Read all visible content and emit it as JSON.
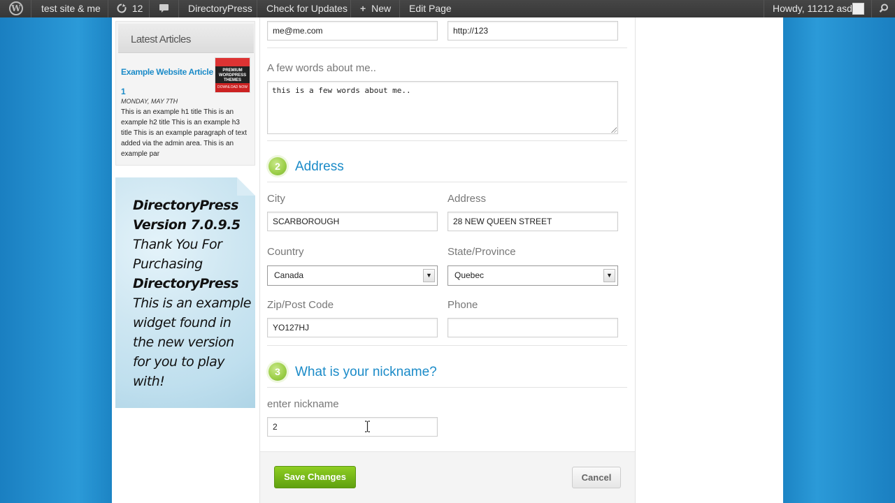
{
  "adminbar": {
    "site_name": "test site & me",
    "updates_count": "12",
    "plugin": "DirectoryPress",
    "check_updates": "Check for Updates",
    "new_label": "New",
    "edit_page": "Edit Page",
    "howdy": "Howdy, 11212 asd"
  },
  "sidebar": {
    "latest_title": "Latest Articles",
    "article_title": "Example Website Article 1",
    "article_date": "MONDAY, MAY 7TH",
    "article_excerpt": "This is an example h1 title This is an example h2 title This is an example h3 title This is an example paragraph of text added via the admin area. This is an example par",
    "widget_line1": "DirectoryPress",
    "widget_line2": "Version 7.0.9.5",
    "widget_line3": "Thank You For Purchasing",
    "widget_line4": "DirectoryPress",
    "widget_line5": "This is an example widget found in the new version for you to play with!"
  },
  "form": {
    "email_value": "me@me.com",
    "website_value": "http://123",
    "about_label": "A few words about me..",
    "about_value": "this is a few words about me..",
    "section2_number": "2",
    "section2_title": "Address",
    "city_label": "City",
    "city_value": "SCARBOROUGH",
    "address_label": "Address",
    "address_value": "28 NEW QUEEN STREET",
    "country_label": "Country",
    "country_value": "Canada",
    "state_label": "State/Province",
    "state_value": "Quebec",
    "zip_label": "Zip/Post Code",
    "zip_value": "YO127HJ",
    "phone_label": "Phone",
    "phone_value": "",
    "section3_number": "3",
    "section3_title": "What is your nickname?",
    "nickname_label": "enter nickname",
    "nickname_value": "2"
  },
  "actions": {
    "save": "Save Changes",
    "cancel": "Cancel"
  }
}
